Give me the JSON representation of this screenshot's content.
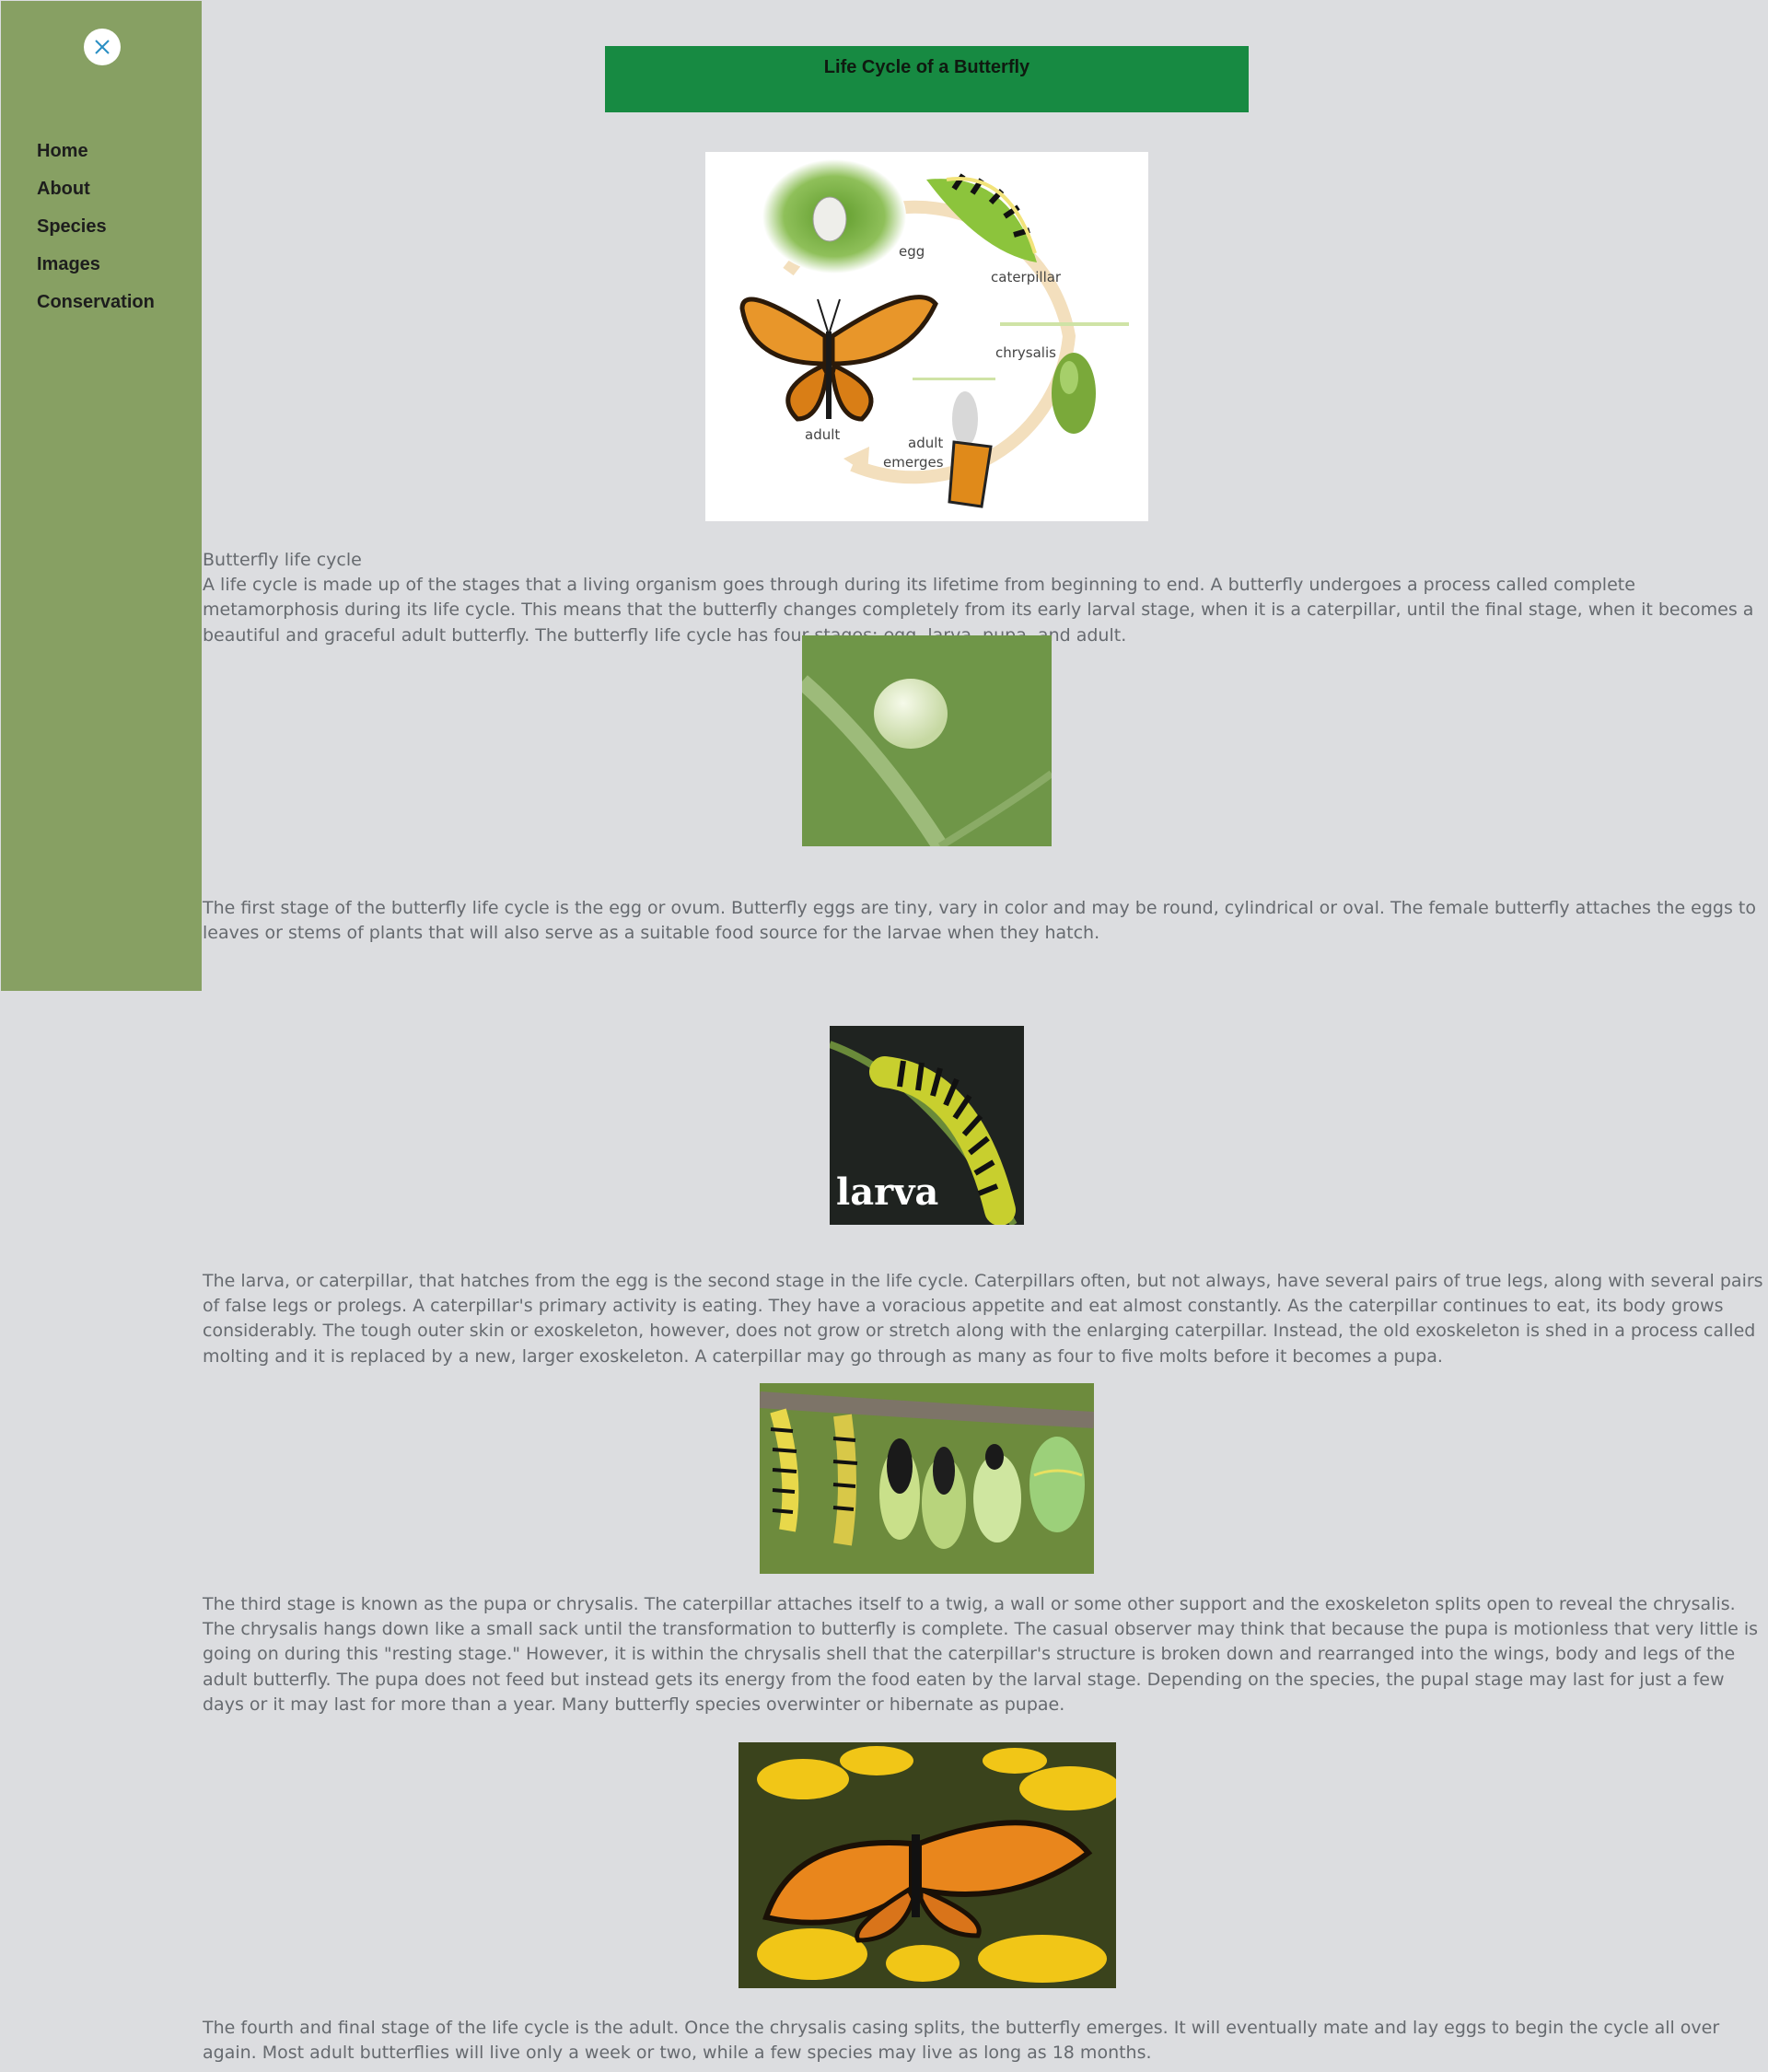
{
  "sidebar": {
    "close_icon": "close-x-icon",
    "nav": [
      {
        "label": "Home"
      },
      {
        "label": "About"
      },
      {
        "label": "Species"
      },
      {
        "label": "Images"
      },
      {
        "label": "Conservation"
      }
    ]
  },
  "header": {
    "title": "Life Cycle of a Butterfly"
  },
  "diagram": {
    "labels": {
      "egg": "egg",
      "caterpillar": "caterpillar",
      "chrysalis": "chrysalis",
      "adult": "adult",
      "emerges_1": "adult",
      "emerges_2": "emerges"
    }
  },
  "intro": {
    "heading": "Butterfly life cycle",
    "body": "A life cycle is made up of the stages that a living organism goes through during its lifetime from beginning to end. A butterfly undergoes a process called complete metamorphosis during its life cycle. This means that the butterfly changes completely from its early larval stage, when it is a caterpillar, until the final stage, when it becomes a beautiful and graceful adult butterfly. The butterfly life cycle has four stages: egg, larva, pupa, and adult."
  },
  "egg_section": {
    "body": " The first stage of the butterfly life cycle is the egg or ovum. Butterfly eggs are tiny, vary in color and may be round, cylindrical or oval. The female butterfly attaches the eggs to leaves or stems of plants that will also serve as a suitable food source for the larvae when they hatch."
  },
  "larva_section": {
    "image_caption": "larva",
    "body": "The larva, or caterpillar, that hatches from the egg is the second stage in the life cycle. Caterpillars often, but not always, have several pairs of true legs, along with several pairs of false legs or prolegs. A caterpillar's primary activity is eating. They have a voracious appetite and eat almost constantly. As the caterpillar continues to eat, its body grows considerably. The tough outer skin or exoskeleton, however, does not grow or stretch along with the enlarging caterpillar. Instead, the old exoskeleton is shed in a process called molting and it is replaced by a new, larger exoskeleton. A caterpillar may go through as many as four to five molts before it becomes a pupa."
  },
  "pupa_section": {
    "body": "The third stage is known as the pupa or chrysalis. The caterpillar attaches itself to a twig, a wall or some other support and the exoskeleton splits open to reveal the chrysalis. The chrysalis hangs down like a small sack until the transformation to butterfly is complete. The casual observer may think that because the pupa is motionless that very little is going on during this \"resting stage.\" However, it is within the chrysalis shell that the caterpillar's structure is broken down and rearranged into the wings, body and legs of the adult butterfly. The pupa does not feed but instead gets its energy from the food eaten by the larval stage. Depending on the species, the pupal stage may last for just a few days or it may last for more than a year. Many butterfly species overwinter or hibernate as pupae."
  },
  "adult_section": {
    "body": "The fourth and final stage of the life cycle is the adult. Once the chrysalis casing splits, the butterfly emerges. It will eventually mate and lay eggs to begin the cycle all over again. Most adult butterflies will live only a week or two, while a few species may live as long as 18 months."
  },
  "colors": {
    "page_bg": "#dcdde0",
    "sidebar_bg": "#87a063",
    "banner_bg": "#178a42",
    "body_text": "#666a6f",
    "nav_text": "#1d1d1d"
  }
}
